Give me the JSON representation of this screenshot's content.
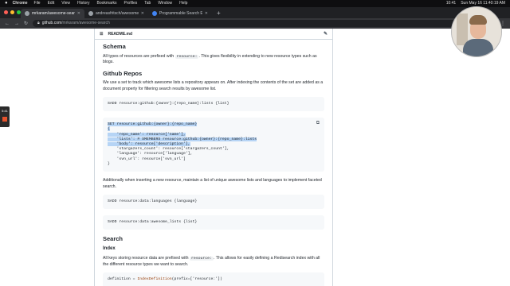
{
  "menubar": {
    "app": "Chrome",
    "items": [
      "File",
      "Edit",
      "View",
      "History",
      "Bookmarks",
      "Profiles",
      "Tab",
      "Window",
      "Help"
    ],
    "time": "10:41",
    "clock": "Sun May 16 11:40:19 AM"
  },
  "tabs": [
    {
      "title": "mrkaram/awesome-search"
    },
    {
      "title": "andreasfritsch/awesome"
    },
    {
      "title": "Programmable Search Engine"
    }
  ],
  "address": {
    "host": "github.com",
    "path": "/mrkaram/awesome-search"
  },
  "side_panel": {
    "time": "5:41"
  },
  "readme": {
    "filename": "README.md",
    "schema_heading": "Schema",
    "schema_text_1": "All types of resources are prefixed with",
    "schema_code": "resource:",
    "schema_text_2": ". This gives flexibility in extending to new resource types such as blogs.",
    "repos_heading": "Github Repos",
    "repos_text": "We use a set to track which awesome lists a repository appears on. After indexing the contents of the set are added as a document property for filtering search results by awesome list.",
    "code1": "SADD resource:github:{owner}:{repo_name}:lists {list}",
    "code2_hl": "SET resource:github:{owner}:{repo_name}\n{\n    'repo_name': resource['name'],\n    'lists': # SMEMBERS resource:github:{owner}:{repo_name}:lists\n    'body': resource['description'],",
    "code2_rest": "    'stargazers_count': resource['stargazers_count'],\n    'language': resource['language'],\n    'svn_url': resource['svn_url']\n}",
    "unique_text": "Additionally when inserting a new resource, maintain a list of unique awesome lists and languages to implement faceted search.",
    "code3": "SADD resource:data:languages {language}",
    "code4": "SADD resource:data:awesome_lists {list}",
    "search_heading": "Search",
    "index_heading": "Index",
    "index_text_1": "All keys storing resource data are prefixed with",
    "index_code": "resource:",
    "index_text_2": ". This allows for easily defining a Redisearch index with all the different resource types we want to search.",
    "code5_a": "definition = ",
    "code5_fn": "IndexDefinition",
    "code5_b": "(prefix=['resource:'])"
  }
}
